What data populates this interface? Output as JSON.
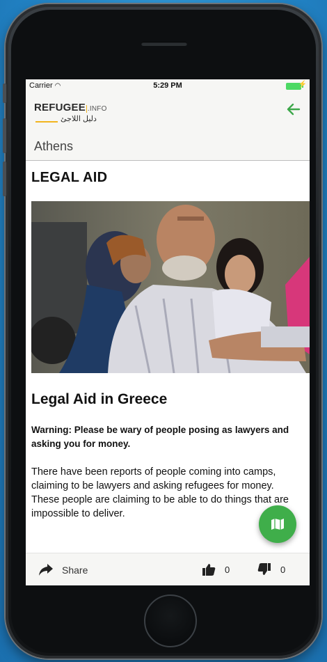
{
  "status_bar": {
    "carrier": "Carrier",
    "time": "5:29 PM"
  },
  "header": {
    "logo_en": "REFUGEE",
    "logo_info": ".INFO",
    "logo_ar": "دليل اللاجئ",
    "back_icon": "arrow-left-icon"
  },
  "location": {
    "label": "Athens"
  },
  "main": {
    "heading": "LEGAL AID",
    "article_title": "Legal Aid in Greece",
    "warning": "Warning: Please be wary of people posing as lawyers and asking you for money.",
    "body": "There have been reports of people coming into camps, claiming to be lawyers and asking refugees for money. These people are claiming to be able to do things that are impossible to deliver."
  },
  "fab": {
    "icon": "map-icon"
  },
  "bottom_bar": {
    "share_label": "Share",
    "like_count": "0",
    "dislike_count": "0"
  },
  "colors": {
    "accent_green": "#3fae4a",
    "logo_yellow": "#f2b51e",
    "background_blue": "#2b8fd0"
  }
}
